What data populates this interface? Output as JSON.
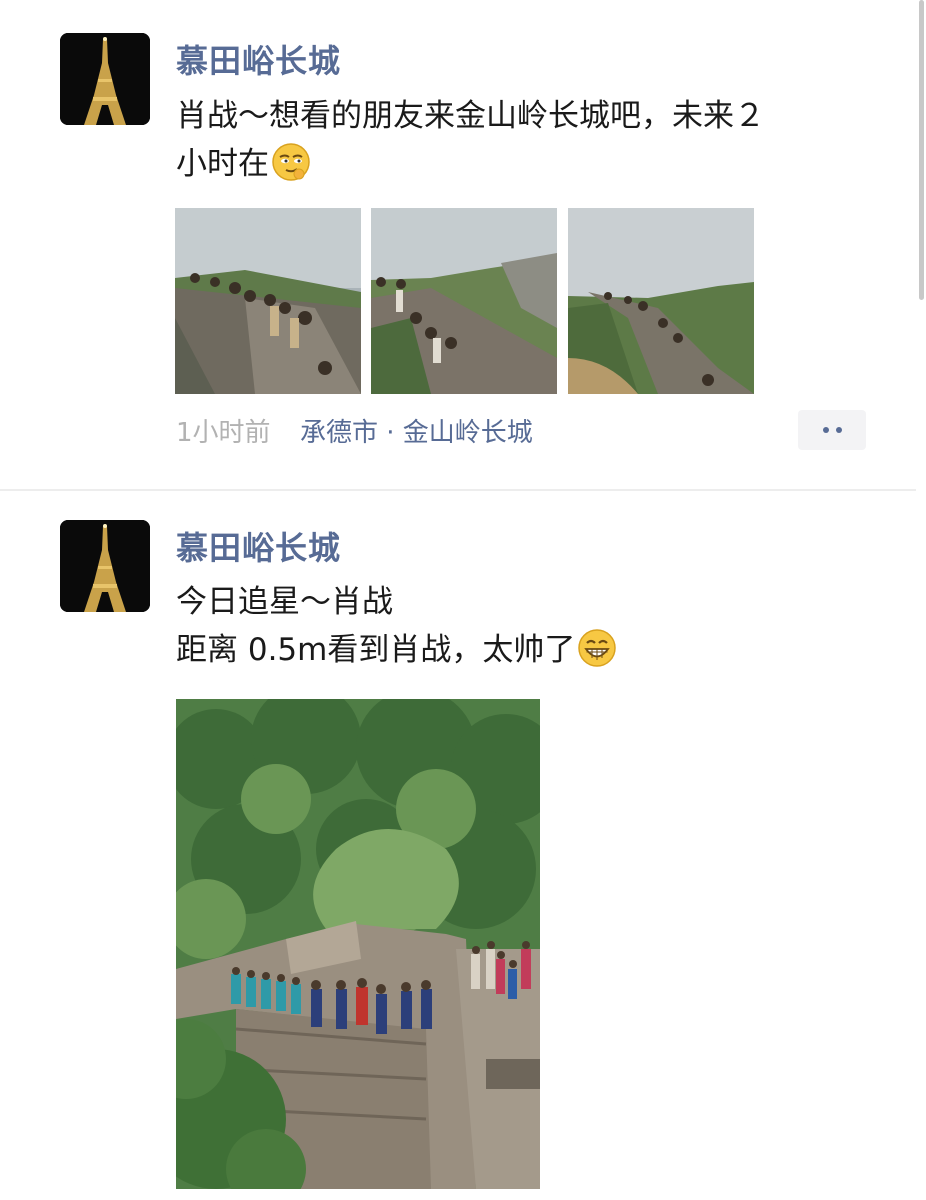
{
  "feed": {
    "posts": [
      {
        "author": "慕田峪长城",
        "text_line1": "肖战～想看的朋友来金山岭长城吧，未来２",
        "text_line2": "小时在",
        "emoji": "smirk-emoji",
        "images": [
          "great-wall-stairs-photo-1",
          "great-wall-stairs-photo-2",
          "great-wall-stairs-photo-3"
        ],
        "time": "1小时前",
        "location": "承德市 · 金山岭长城"
      },
      {
        "author": "慕田峪长城",
        "text_line1": "今日追星～肖战",
        "text_line2": "距离 0.5m看到肖战，太帅了",
        "emoji": "grin-emoji",
        "images": [
          "great-wall-crowd-photo"
        ]
      }
    ]
  },
  "colors": {
    "nickname": "#576b95",
    "body_text": "#1a1a1a",
    "time_text": "#b2b2b2",
    "background": "#ffffff"
  }
}
